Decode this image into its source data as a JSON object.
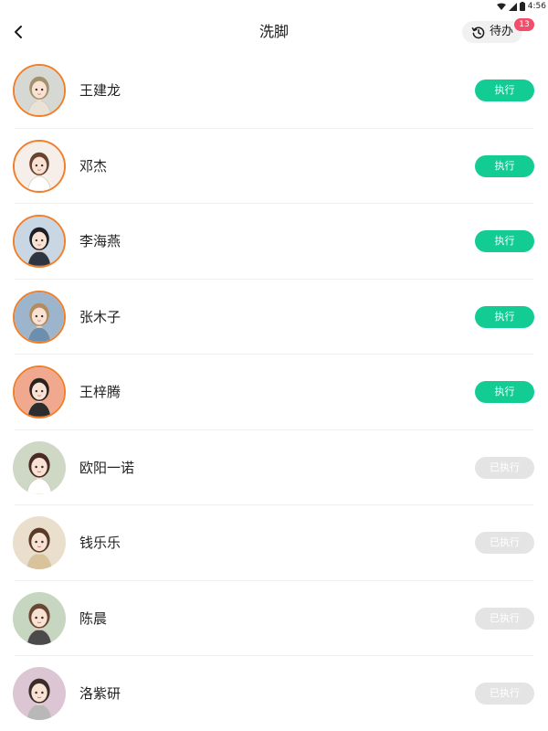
{
  "status_bar": {
    "time": "4:56"
  },
  "header": {
    "title": "洗脚",
    "todo_label": "待办",
    "todo_count": "13"
  },
  "colors": {
    "accent": "#12cc94",
    "badge": "#f24d6b",
    "avatar_ring": "#f07f2c",
    "disabled": "#e4e4e4"
  },
  "people": [
    {
      "name": "王建龙",
      "action": "执行",
      "status": "pending",
      "icon": "avatar-girl-braid",
      "bg": "#d6d9d3",
      "hair": "#a3906c",
      "cloth": "#e9e2d6"
    },
    {
      "name": "邓杰",
      "action": "执行",
      "status": "pending",
      "icon": "avatar-girl-pigtails",
      "bg": "#f6efe9",
      "hair": "#6a4230",
      "cloth": "#ffffff"
    },
    {
      "name": "李海燕",
      "action": "执行",
      "status": "pending",
      "icon": "avatar-man-glasses",
      "bg": "#c9d6e4",
      "hair": "#1d1f24",
      "cloth": "#2e3440"
    },
    {
      "name": "张木子",
      "action": "执行",
      "status": "pending",
      "icon": "avatar-girl-headscarf",
      "bg": "#9cb5cc",
      "hair": "#b48a5f",
      "cloth": "#6c8fb0"
    },
    {
      "name": "王梓腾",
      "action": "执行",
      "status": "pending",
      "icon": "avatar-girl-straw-hat",
      "bg": "#f0a98f",
      "hair": "#2b2320",
      "cloth": "#2d2d2d"
    },
    {
      "name": "欧阳一诺",
      "action": "已执行",
      "status": "done",
      "icon": "avatar-girl-curly",
      "bg": "#cfd7c5",
      "hair": "#4a2a24",
      "cloth": "#ffffff"
    },
    {
      "name": "钱乐乐",
      "action": "已执行",
      "status": "done",
      "icon": "avatar-girl-beret",
      "bg": "#eadfcc",
      "hair": "#5a3b28",
      "cloth": "#d9c39a"
    },
    {
      "name": "陈晨",
      "action": "已执行",
      "status": "done",
      "icon": "avatar-girl-flower",
      "bg": "#c7d6c0",
      "hair": "#6b4632",
      "cloth": "#4b4b4b"
    },
    {
      "name": "洛紫研",
      "action": "已执行",
      "status": "done",
      "icon": "avatar-girl-cat",
      "bg": "#dcc6d4",
      "hair": "#3a2c2a",
      "cloth": "#b8b8b8"
    }
  ]
}
